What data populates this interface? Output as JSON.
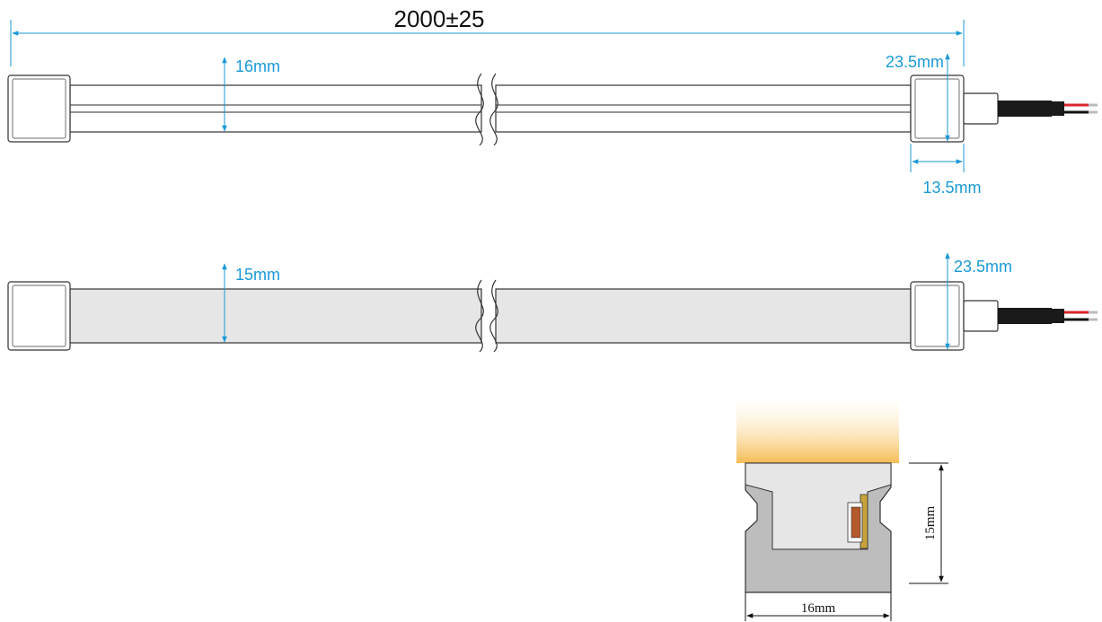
{
  "top_view": {
    "total_length_label": "2000±25",
    "width_label": "16mm",
    "end_cap_height_label": "23.5mm",
    "end_cap_length_label": "13.5mm"
  },
  "side_view": {
    "width_label": "15mm",
    "end_cap_height_label": "23.5mm"
  },
  "cross_section": {
    "height_label": "15mm",
    "width_label": "16mm"
  },
  "colors": {
    "dimension_line": "#1a9ad6",
    "outline": "#333333",
    "silicone_fill": "#e6e6e6",
    "profile_fill": "#bdbdbd",
    "cable": "#1a1a1a",
    "wire_red": "#d9262b",
    "glow": "#f5c25a"
  }
}
